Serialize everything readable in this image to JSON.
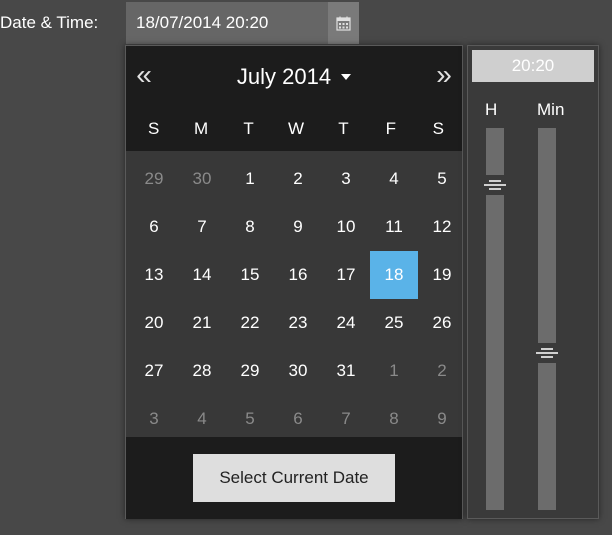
{
  "field": {
    "label": "Date & Time:",
    "value": "18/07/2014 20:20"
  },
  "icons": {
    "calendar_button": "calendar-icon",
    "prev": "double-chevron-left-icon",
    "next": "double-chevron-right-icon"
  },
  "calendar": {
    "month_label": "July 2014",
    "prev_symbol": "«",
    "next_symbol": "»",
    "weekdays": [
      "S",
      "M",
      "T",
      "W",
      "T",
      "F",
      "S"
    ],
    "days": [
      {
        "label": "29",
        "muted": true
      },
      {
        "label": "30",
        "muted": true
      },
      {
        "label": "1"
      },
      {
        "label": "2"
      },
      {
        "label": "3"
      },
      {
        "label": "4"
      },
      {
        "label": "5"
      },
      {
        "label": "6"
      },
      {
        "label": "7"
      },
      {
        "label": "8"
      },
      {
        "label": "9"
      },
      {
        "label": "10"
      },
      {
        "label": "11"
      },
      {
        "label": "12"
      },
      {
        "label": "13"
      },
      {
        "label": "14"
      },
      {
        "label": "15"
      },
      {
        "label": "16"
      },
      {
        "label": "17"
      },
      {
        "label": "18",
        "selected": true
      },
      {
        "label": "19"
      },
      {
        "label": "20"
      },
      {
        "label": "21"
      },
      {
        "label": "22"
      },
      {
        "label": "23"
      },
      {
        "label": "24"
      },
      {
        "label": "25"
      },
      {
        "label": "26"
      },
      {
        "label": "27"
      },
      {
        "label": "28"
      },
      {
        "label": "29"
      },
      {
        "label": "30"
      },
      {
        "label": "31"
      },
      {
        "label": "1",
        "muted": true
      },
      {
        "label": "2",
        "muted": true
      },
      {
        "label": "3",
        "muted": true
      },
      {
        "label": "4",
        "muted": true
      },
      {
        "label": "5",
        "muted": true
      },
      {
        "label": "6",
        "muted": true
      },
      {
        "label": "7",
        "muted": true
      },
      {
        "label": "8",
        "muted": true
      },
      {
        "label": "9",
        "muted": true
      }
    ],
    "select_current_label": "Select Current Date"
  },
  "time": {
    "display": "20:20",
    "hour_label": "H",
    "minute_label": "Min",
    "hour_value": 20,
    "hour_max": 23,
    "minute_value": 20,
    "minute_max": 59
  },
  "colors": {
    "selected_day": "#5ab3e8",
    "background": "#484848",
    "header": "#1c1c1c"
  }
}
